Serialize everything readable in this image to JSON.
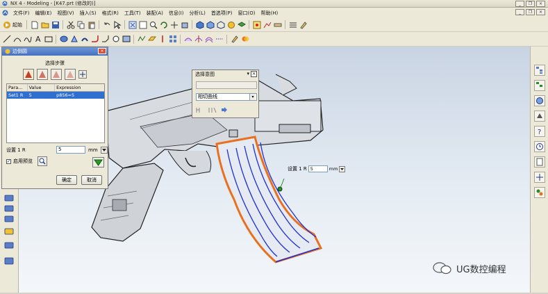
{
  "window": {
    "title": "NX 4 - Modeling - [K47.prt (修改的)]",
    "buttons": [
      "_",
      "❐",
      "×"
    ]
  },
  "menu": {
    "items": [
      "文件(F)",
      "编辑(E)",
      "视图(V)",
      "插入(S)",
      "格式(R)",
      "工具(T)",
      "装配(A)",
      "信息(I)",
      "分析(L)",
      "首选项(P)",
      "窗口(O)",
      "帮助(H)"
    ]
  },
  "toolbar": {
    "start_label": "起始"
  },
  "edge_blend_dialog": {
    "title": "边倒圆",
    "group_label": "选择步骤",
    "table_headers": [
      "Para...",
      "Value",
      "Expression"
    ],
    "table_row": [
      "Set1 R",
      "5",
      "p856=5"
    ],
    "radius_label": "设置 1 R",
    "radius_value": "5",
    "unit": "mm",
    "preview_label": "启用预览",
    "ok_label": "确定",
    "cancel_label": "取消"
  },
  "intent_dialog": {
    "title": "选择意图",
    "dropdown_value": "相切曲线"
  },
  "onscreen_input": {
    "label": "设置 1 R",
    "value": "5",
    "unit": "mm"
  },
  "watermark": {
    "text": "UG数控编程"
  },
  "colors": {
    "accent": "#2f6fd0",
    "dialog_title": "#4470c3",
    "edge_highlight": "#e8701f",
    "curve_blue": "#1c2fd8"
  }
}
